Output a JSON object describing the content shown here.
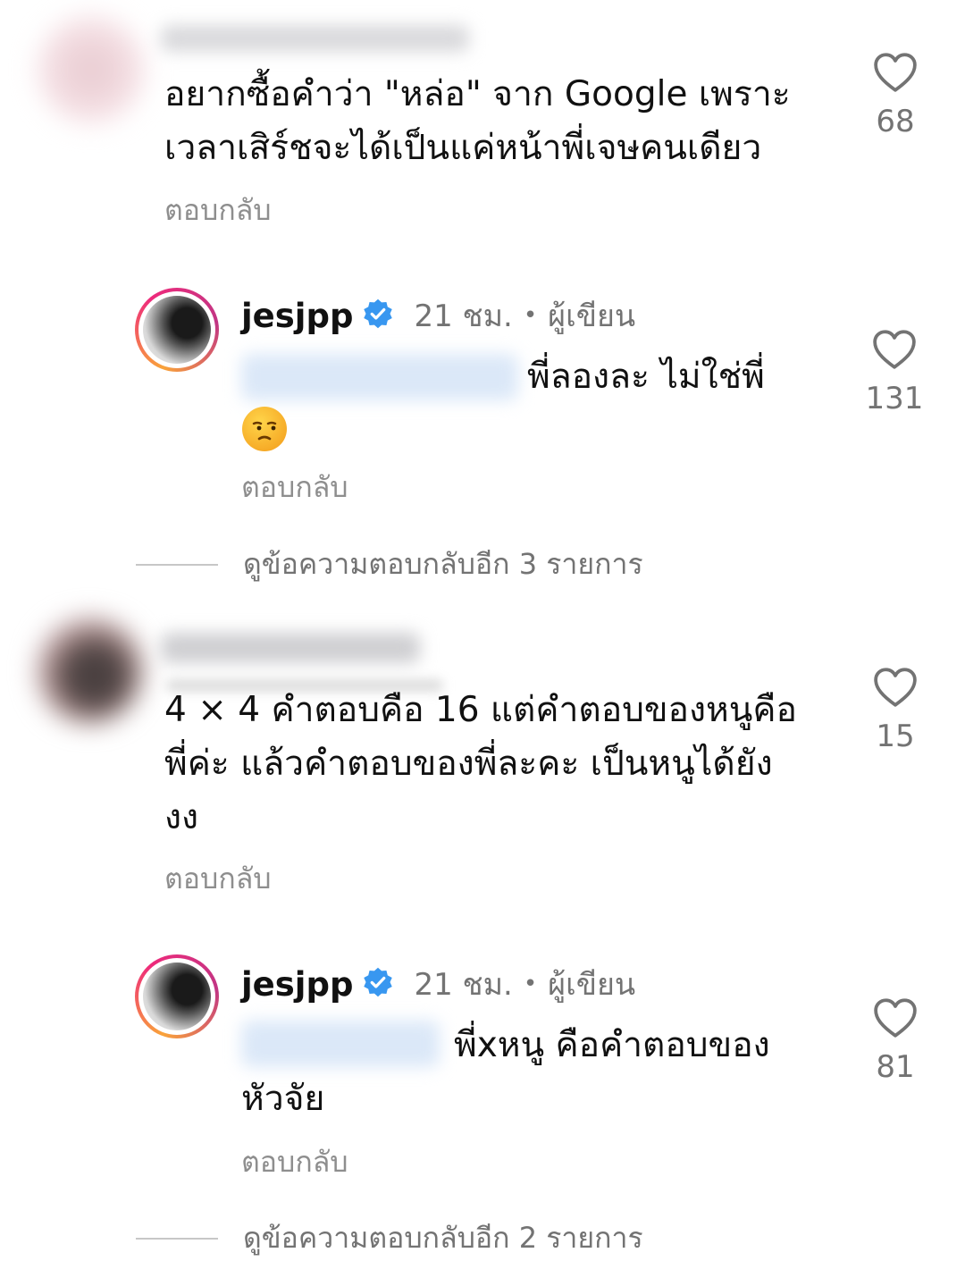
{
  "comments": [
    {
      "text_line1": "อยากซื้อคำว่า \"หล่อ\" จาก Google เพราะ",
      "text_line2": "เวลาเสิร์ชจะได้เป็นแค่หน้าพี่เจษคนเดียว",
      "reply_label": "ตอบกลับ",
      "likes": "68"
    },
    {
      "text_line1": "4 × 4 คำตอบคือ 16 แต่คำตอบของหนูคือ",
      "text_line2": "พี่ค่ะ แล้วคำตอบของพี่ละคะ เป็นหนูได้ยัง",
      "text_line3": "งง",
      "reply_label": "ตอบกลับ",
      "likes": "15"
    }
  ],
  "replies": [
    {
      "author": "jesjpp",
      "time": "21 ชม.",
      "separator": "•",
      "role": "ผู้เขียน",
      "text_line1": "พี่ลองละ ไม่ใช่พี่",
      "emoji": "unamused-face-emoji",
      "reply_label": "ตอบกลับ",
      "likes": "131",
      "view_more": "ดูข้อความตอบกลับอีก 3 รายการ"
    },
    {
      "author": "jesjpp",
      "time": "21 ชม.",
      "separator": "•",
      "role": "ผู้เขียน",
      "text_line1": "พี่xหนู คือคำตอบของ",
      "text_line2": "หัวจัย",
      "reply_label": "ตอบกลับ",
      "likes": "81",
      "view_more": "ดูข้อความตอบกลับอีก 2 รายการ"
    }
  ],
  "icons": {
    "like": "heart-outline-icon",
    "verified": "verified-badge-icon"
  },
  "colors": {
    "verified_blue": "#3897f0",
    "secondary_text": "#737373"
  }
}
